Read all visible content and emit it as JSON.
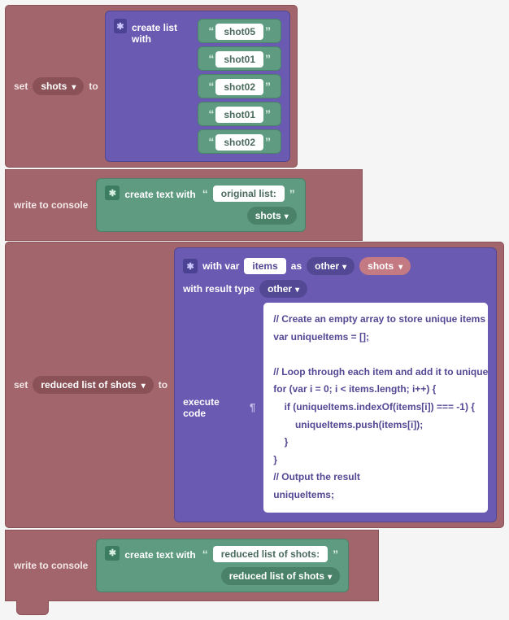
{
  "block1": {
    "set": "set",
    "varname": "shots",
    "to": "to",
    "create_list": "create list with",
    "items": [
      "shot05",
      "shot01",
      "shot02",
      "shot01",
      "shot02"
    ]
  },
  "block2": {
    "write": "write to console",
    "create_text": "create text with",
    "literal": "original list:",
    "varref": "shots"
  },
  "block3": {
    "set": "set",
    "varname": "reduced list of shots",
    "to": "to",
    "with_var": "with var",
    "items_name": "items",
    "as": "as",
    "other1": "other",
    "shots_ref": "shots",
    "with_result": "with result type",
    "other2": "other",
    "execute": "execute code",
    "code": "// Create an empty array to store unique items\nvar uniqueItems = [];\n\n// Loop through each item and add it to unique...\nfor (var i = 0; i < items.length; i++) {\n    if (uniqueItems.indexOf(items[i]) === -1) {\n        uniqueItems.push(items[i]);\n    }\n}\n// Output the result\nuniqueItems;"
  },
  "block4": {
    "write": "write to console",
    "create_text": "create text with",
    "literal": "reduced list of shots:",
    "varref": "reduced list of shots"
  }
}
